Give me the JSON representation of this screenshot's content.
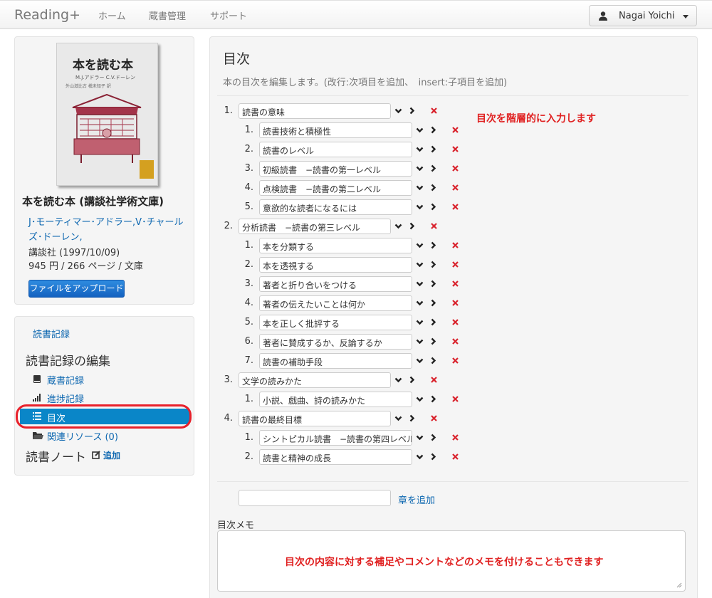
{
  "navbar": {
    "brand": "Reading+",
    "links": [
      "ホーム",
      "蔵書管理",
      "サポート"
    ],
    "user": "Nagai Yoichi"
  },
  "book": {
    "cover_title": "本を読む本",
    "cover_author": "M.J.アドラー C.V.ドーレン",
    "cover_translator": "外山滋比古  槇未知子 訳",
    "title": "本を読む本 (講談社学術文庫)",
    "authors": "J･モーティマー･アドラー,V･チャールズ･ドーレン,",
    "publisher": "講談社 (1997/10/09)",
    "price_pages": "945 円 / 266 ページ / 文庫",
    "upload_button": "ファイルをアップロード"
  },
  "sidebar": {
    "record_link": "読書記録",
    "edit_heading": "読書記録の編集",
    "items": [
      {
        "label": "蔵書記録",
        "icon": "book-icon"
      },
      {
        "label": "進捗記録",
        "icon": "signal-icon"
      },
      {
        "label": "目次",
        "icon": "list-icon"
      },
      {
        "label": "関連リソース (0)",
        "icon": "folder-icon"
      }
    ],
    "note_heading": "読書ノート",
    "note_add": "追加"
  },
  "main": {
    "title": "目次",
    "subtitle": "本の目次を編集します。(改行:次項目を追加、　insert:子項目を追加)",
    "hint": "目次を階層的に入力します",
    "chapters": [
      {
        "num": "1.",
        "title": "読書の意味",
        "items": [
          {
            "num": "1.",
            "title": "読書技術と積極性"
          },
          {
            "num": "2.",
            "title": "読書のレベル"
          },
          {
            "num": "3.",
            "title": "初級読書　−読書の第一レベル"
          },
          {
            "num": "4.",
            "title": "点検読書　−読書の第二レベル"
          },
          {
            "num": "5.",
            "title": "意欲的な読者になるには"
          }
        ]
      },
      {
        "num": "2.",
        "title": "分析読書　−読書の第三レベル",
        "items": [
          {
            "num": "1.",
            "title": "本を分類する"
          },
          {
            "num": "2.",
            "title": "本を透視する"
          },
          {
            "num": "3.",
            "title": "著者と折り合いをつける"
          },
          {
            "num": "4.",
            "title": "著者の伝えたいことは何か"
          },
          {
            "num": "5.",
            "title": "本を正しく批評する"
          },
          {
            "num": "6.",
            "title": "著者に賛成するか、反論するか"
          },
          {
            "num": "7.",
            "title": "読書の補助手段"
          }
        ]
      },
      {
        "num": "3.",
        "title": "文学の読みかた",
        "items": [
          {
            "num": "1.",
            "title": "小説、戯曲、詩の読みかた"
          }
        ]
      },
      {
        "num": "4.",
        "title": "読書の最終目標",
        "items": [
          {
            "num": "1.",
            "title": "シントピカル読書　−読書の第四レベル"
          },
          {
            "num": "2.",
            "title": "読書と精神の成長"
          }
        ]
      }
    ],
    "add_chapter_placeholder": "",
    "add_chapter": "章を追加",
    "memo_label": "目次メモ",
    "memo_hint": "目次の内容に対する補足やコメントなどのメモを付けることもできます"
  },
  "colors": {
    "accent": "#0a86c8",
    "link": "#0d67b0",
    "annotation": "#e02020"
  }
}
